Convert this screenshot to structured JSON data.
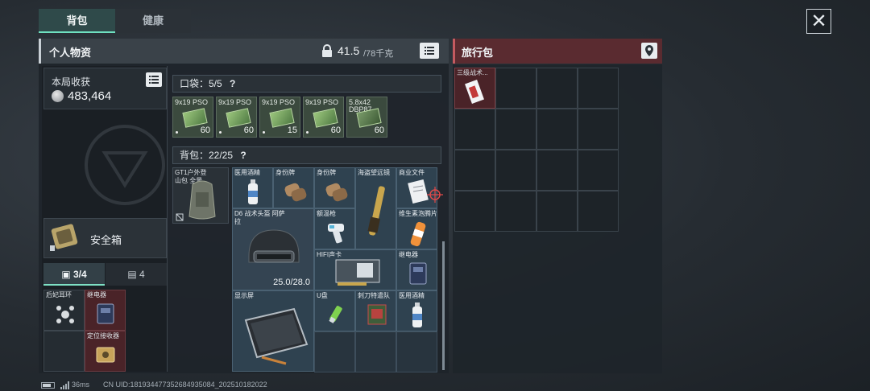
{
  "tabs": {
    "backpack": "背包",
    "health": "健康"
  },
  "personal": {
    "title": "个人物资",
    "weight_value": "41.5",
    "weight_max": "/78千克"
  },
  "earnings": {
    "label": "本局收获",
    "value": "483,464"
  },
  "safebox": {
    "label": "安全箱"
  },
  "subtabs": {
    "kit": "3/4",
    "cards": "4"
  },
  "side_slots": [
    {
      "label": "后妃耳环"
    },
    {
      "label": "继电器"
    },
    {
      "label": ""
    },
    {
      "label": "定位接收器"
    }
  ],
  "pocket": {
    "header": "口袋：5/5",
    "help": "?",
    "ammo": [
      {
        "name": "9x19 PSO",
        "count": "60"
      },
      {
        "name": "9x19 PSO",
        "count": "60"
      },
      {
        "name": "9x19 PSO",
        "count": "15"
      },
      {
        "name": "9x19 PSO",
        "count": "60"
      },
      {
        "name": "5.8x42 DBP87",
        "count": "60"
      }
    ]
  },
  "backpack": {
    "header": "背包：22/25",
    "help": "?",
    "bag_name": "GT1户外登山包 全景",
    "items": {
      "medical1": "医用酒精",
      "idcard1": "身份牌",
      "idcard2": "身份牌",
      "telescope": "海盗望远镜",
      "document": "商业文件",
      "helmet": "D6 战术头盔 阿萨拉",
      "helmet_durability": "25.0/28.0",
      "thermometer": "额温枪",
      "vitamin": "维生素泡腾片",
      "hifi": "HIFI声卡",
      "relay": "继电器",
      "monitor": "显示屏",
      "usb": "U盘",
      "knife": "刺刀特遣队",
      "medical2": "医用酒精"
    }
  },
  "travel": {
    "title": "旅行包",
    "item_label": "三级战术..."
  },
  "status": {
    "ping": "36ms",
    "uid": "CN UID:1819344773526849350​84_202510182022"
  },
  "colors": {
    "accent": "#6fe0c0",
    "travel_header": "#5a2b30",
    "pocket_ammo": "#3b4a3e",
    "backpack_item": "#2f4250",
    "safe_red": "#4a2328"
  }
}
